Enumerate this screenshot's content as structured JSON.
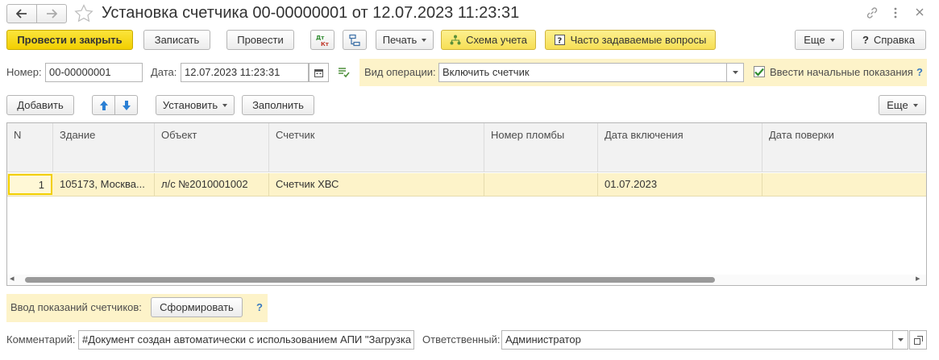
{
  "window": {
    "title": "Установка счетчика 00-00000001 от 12.07.2023 11:23:31"
  },
  "toolbar": {
    "post_close": "Провести и закрыть",
    "save": "Записать",
    "post": "Провести",
    "print": "Печать",
    "scheme": "Схема учета",
    "faq": "Часто задаваемые вопросы",
    "more": "Еще",
    "help": "Справка"
  },
  "form": {
    "number_label": "Номер:",
    "number_value": "00-00000001",
    "date_label": "Дата:",
    "date_value": "12.07.2023 11:23:31",
    "operation_label": "Вид операции:",
    "operation_value": "Включить счетчик",
    "initial_readings_label": "Ввести начальные показания",
    "initial_readings_checked": true,
    "help_mark": "?"
  },
  "table_toolbar": {
    "add": "Добавить",
    "set": "Установить",
    "fill": "Заполнить",
    "more": "Еще"
  },
  "table": {
    "columns": [
      "N",
      "Здание",
      "Объект",
      "Счетчик",
      "Номер пломбы",
      "Дата включения",
      "Дата поверки"
    ],
    "rows": [
      [
        "1",
        "105173, Москва...",
        "л/с №2010001002",
        "Счетчик ХВС",
        "",
        "01.07.2023",
        ""
      ]
    ],
    "scroll_left": "◂",
    "scroll_right": "▸"
  },
  "readings": {
    "label": "Ввод показаний счетчиков:",
    "button": "Сформировать",
    "help_mark": "?"
  },
  "footer": {
    "comment_label": "Комментарий:",
    "comment_value": "#Документ создан автоматически с использованием АПИ \"Загрузка",
    "responsible_label": "Ответственный:",
    "responsible_value": "Администратор"
  },
  "colors": {
    "accent_yellow": "#f2cf00",
    "highlight_row": "#fdf3c9",
    "checkbox_green": "#2e8b2e",
    "arrow_blue": "#2a7fd4"
  }
}
